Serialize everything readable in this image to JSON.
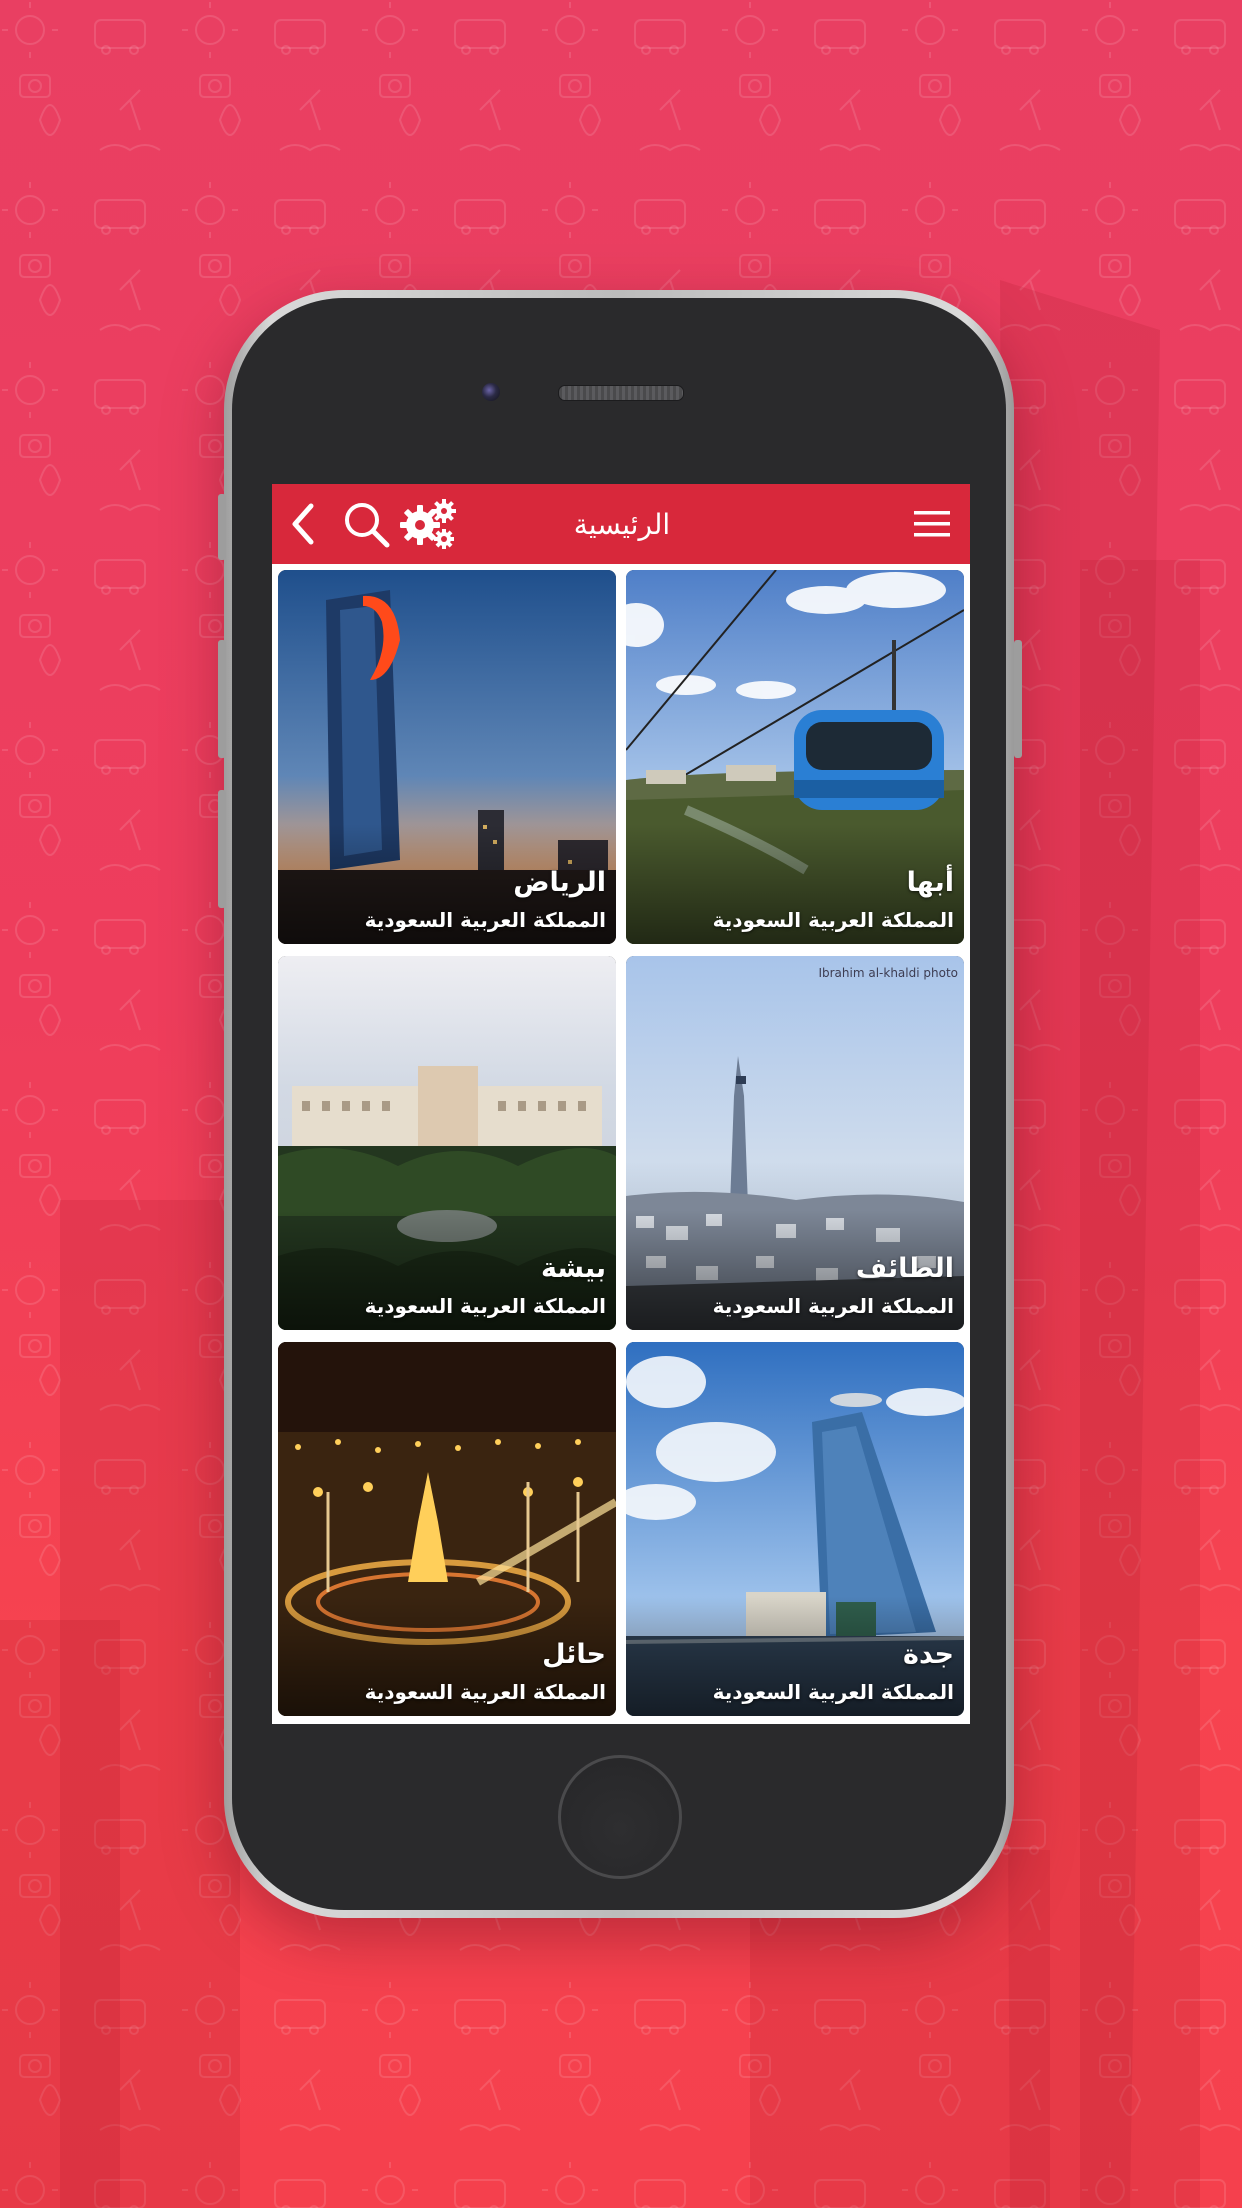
{
  "header": {
    "title": "الرئيسية",
    "back_icon": "chevron-left-icon",
    "search_icon": "search-icon",
    "settings_icon": "gears-icon",
    "menu_icon": "hamburger-menu-icon",
    "color": "#d8283b"
  },
  "cities": [
    {
      "name": "الرياض",
      "country": "المملكة العربية السعودية"
    },
    {
      "name": "أبها",
      "country": "المملكة العربية السعودية"
    },
    {
      "name": "بيشة",
      "country": "المملكة العربية السعودية"
    },
    {
      "name": "الطائف",
      "country": "المملكة العربية السعودية",
      "photo_credit": "Ibrahim al-khaldi   photo"
    },
    {
      "name": "حائل",
      "country": "المملكة العربية السعودية"
    },
    {
      "name": "جدة",
      "country": "المملكة العربية السعودية"
    }
  ],
  "theme": {
    "background": "#ee3d5c",
    "phone_body": "#2a2a2c",
    "phone_frame": "#c4c4c4"
  }
}
